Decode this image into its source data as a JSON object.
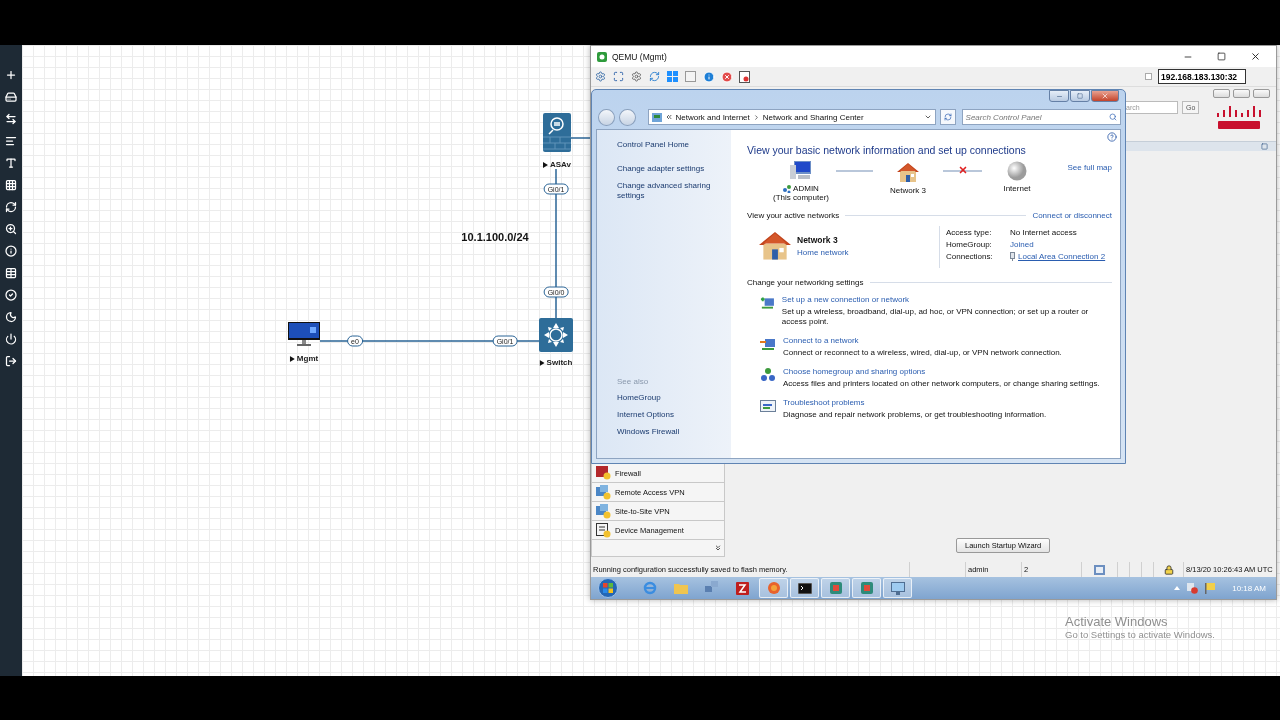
{
  "topology": {
    "nodes": [
      {
        "label": "ASAv",
        "kind": "firewall"
      },
      {
        "label": "Switch",
        "kind": "switch"
      },
      {
        "label": "Mgmt",
        "kind": "pc"
      }
    ],
    "interfaces": [
      "Gi0/1",
      "Gi0/0",
      "e0",
      "Gi0/1"
    ],
    "subnet": "10.1.100.0/24"
  },
  "qemu_window": {
    "title": "QEMU (Mgmt)",
    "address": "192.168.183.130:32",
    "address_option": {
      "checked": false
    }
  },
  "explorer": {
    "breadcrumb": [
      "Network and Internet",
      "Network and Sharing Center"
    ],
    "search_placeholder": "Search Control Panel",
    "sidebar": {
      "links": [
        "Control Panel Home",
        "Change adapter settings",
        "Change advanced sharing settings"
      ],
      "see_also_title": "See also",
      "see_also": [
        "HomeGroup",
        "Internet Options",
        "Windows Firewall"
      ]
    },
    "heading": "View your basic network information and set up connections",
    "map": {
      "nodes": [
        {
          "label": "ADMIN",
          "sublabel": "(This computer)",
          "kind": "computer"
        },
        {
          "label": "Network  3",
          "kind": "house"
        },
        {
          "label": "Internet",
          "kind": "globe"
        }
      ],
      "links": [
        {
          "broken": false
        },
        {
          "broken": true
        }
      ],
      "see_full_map": "See full map"
    },
    "active_networks": {
      "title": "View your active networks",
      "action": "Connect or disconnect",
      "network_name": "Network  3",
      "network_type": "Home network",
      "details": [
        {
          "label": "Access type:",
          "value": "No Internet access",
          "kind": "text"
        },
        {
          "label": "HomeGroup:",
          "value": "Joined",
          "kind": "link"
        },
        {
          "label": "Connections:",
          "value": "Local Area Connection 2",
          "kind": "connection"
        }
      ]
    },
    "settings": {
      "title": "Change your networking settings",
      "tasks": [
        {
          "kind": "new",
          "link": "Set up a new connection or network",
          "description": "Set up a wireless, broadband, dial-up, ad hoc, or VPN connection; or set up a router or access point."
        },
        {
          "kind": "connect",
          "link": "Connect to a network",
          "description": "Connect or reconnect to a wireless, wired, dial-up, or VPN network connection."
        },
        {
          "kind": "homegroup",
          "link": "Choose homegroup and sharing options",
          "description": "Access files and printers located on other network computers, or change sharing settings."
        },
        {
          "kind": "troubleshoot",
          "link": "Troubleshoot problems",
          "description": "Diagnose and repair network problems, or get troubleshooting information."
        }
      ]
    }
  },
  "asdm": {
    "search_placeholder": "arch",
    "go": "Go",
    "nav": [
      {
        "label": "Firewall",
        "kind": "firewall"
      },
      {
        "label": "Remote Access VPN",
        "kind": "vpn"
      },
      {
        "label": "Site-to-Site VPN",
        "kind": "vpn"
      },
      {
        "label": "Device Management",
        "kind": "device"
      }
    ],
    "wizard_button": "Launch Startup Wizard",
    "status": {
      "message": "Running configuration successfully saved to flash memory.",
      "user": "admin",
      "privilege": "2",
      "datetime": "8/13/20 10:26:43 AM UTC"
    }
  },
  "taskbar": {
    "apps": [
      {
        "kind": "ie",
        "running": false
      },
      {
        "kind": "folder",
        "running": false
      },
      {
        "kind": "network",
        "running": false
      },
      {
        "kind": "filezilla",
        "running": false
      },
      {
        "kind": "firefox",
        "running": true
      },
      {
        "kind": "cmd",
        "running": true
      },
      {
        "kind": "app",
        "running": true
      },
      {
        "kind": "app",
        "running": true
      },
      {
        "kind": "monitor",
        "running": true
      }
    ],
    "clock": "10:18 AM"
  },
  "activation": {
    "title": "Activate Windows",
    "subtitle": "Go to Settings to activate Windows."
  }
}
